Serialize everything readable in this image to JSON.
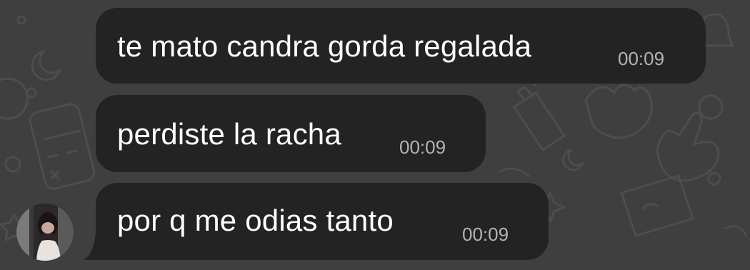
{
  "chat": {
    "messages": [
      {
        "text": "te mato candra gorda regalada",
        "time": "00:09"
      },
      {
        "text": "perdiste la racha",
        "time": "00:09"
      },
      {
        "text": "por q me odias tanto",
        "time": "00:09"
      }
    ],
    "sender_avatar": {
      "icon": "contact-photo-avatar"
    }
  },
  "colors": {
    "wallpaper": "#3f3f3f",
    "bubble": "#232323",
    "message_text": "#ffffff",
    "timestamp": "#b3b3b3"
  }
}
